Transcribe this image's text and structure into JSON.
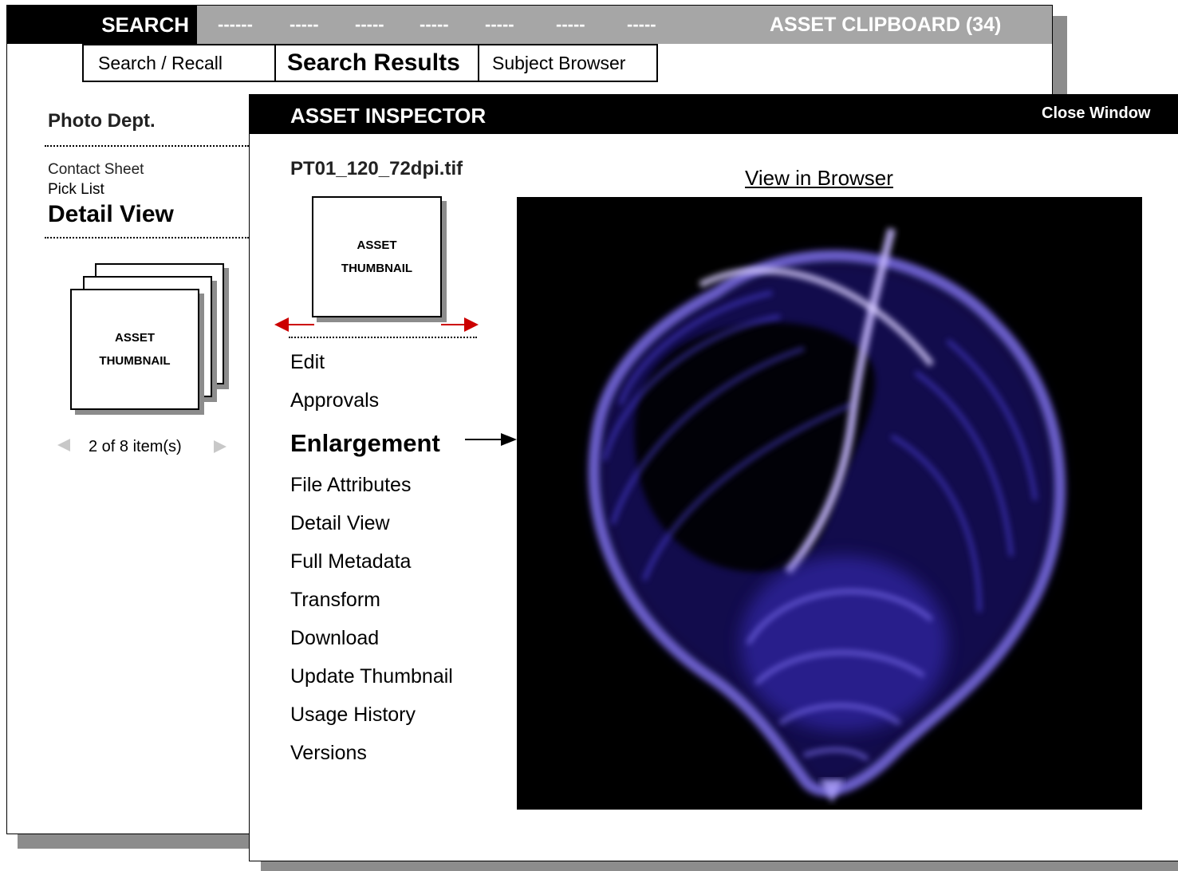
{
  "topbar": {
    "search_label": "SEARCH",
    "placeholders": [
      "------",
      "-----",
      "-----",
      "-----",
      "-----",
      "-----",
      "-----"
    ],
    "clipboard_label": "ASSET CLIPBOARD (34)"
  },
  "subtabs": {
    "search_recall": "Search / Recall",
    "search_results": "Search Results",
    "subject_browser": "Subject Browser"
  },
  "left_panel": {
    "department": "Photo Dept.",
    "views": [
      "Contact Sheet",
      "Pick List",
      "Detail View"
    ],
    "thumbnail_label_1": "ASSET",
    "thumbnail_label_2": "THUMBNAIL",
    "pager_text": "2 of  8 item(s)"
  },
  "inspector": {
    "title": "ASSET INSPECTOR",
    "close_label": "Close Window",
    "filename": "PT01_120_72dpi.tif",
    "view_in_browser": "View in  Browser",
    "thumbnail_label_1": "ASSET",
    "thumbnail_label_2": "THUMBNAIL",
    "menu": [
      "Edit",
      "Approvals",
      "Enlargement",
      "File Attributes",
      "Detail View",
      "Full Metadata",
      "Transform",
      "Download",
      "Update Thumbnail",
      "Usage History",
      "Versions"
    ],
    "selected_menu": "Enlargement"
  },
  "colors": {
    "accent_arrow": "#cc0000",
    "shell_glow": "#9a8cff"
  }
}
